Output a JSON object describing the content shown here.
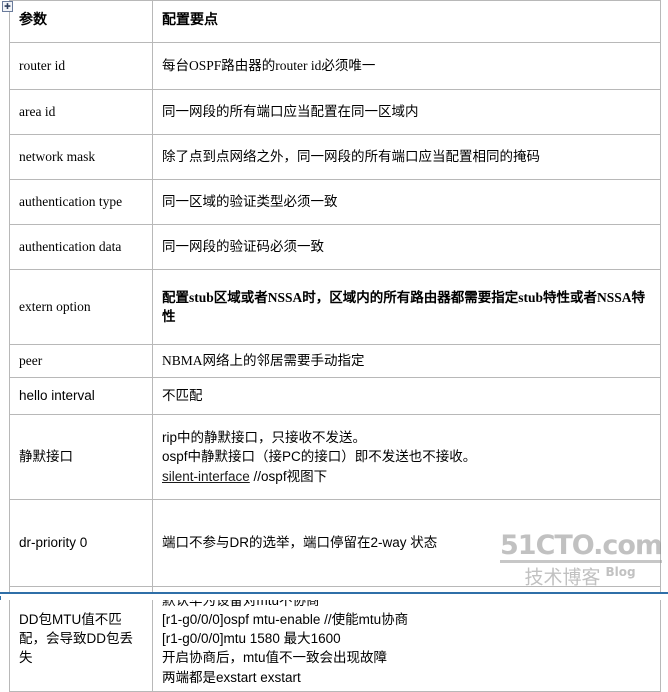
{
  "document": {
    "table_handle_icon": "table-move-handle",
    "columns": [
      "参数",
      "配置要点"
    ],
    "rows": [
      {
        "param": "router id",
        "param_font": "serif",
        "desc_lines": [
          "每台OSPF路由器的router id必须唯一"
        ],
        "desc_bold": false
      },
      {
        "param": "area id",
        "param_font": "serif",
        "desc_lines": [
          "同一网段的所有端口应当配置在同一区域内"
        ],
        "desc_bold": false
      },
      {
        "param": "network mask",
        "param_font": "serif",
        "desc_lines": [
          "除了点到点网络之外，同一网段的所有端口应当配置相同的掩码"
        ],
        "desc_bold": false
      },
      {
        "param": "authentication type",
        "param_font": "serif",
        "desc_lines": [
          "同一区域的验证类型必须一致"
        ],
        "desc_bold": false
      },
      {
        "param": "authentication data",
        "param_font": "serif",
        "desc_lines": [
          "同一网段的验证码必须一致"
        ],
        "desc_bold": false
      },
      {
        "param": "extern option",
        "param_font": "serif",
        "desc_lines": [
          "配置stub区域或者NSSA时，区域内的所有路由器都需要指定stub特性或者NSSA特性"
        ],
        "desc_bold": true
      },
      {
        "param": "peer",
        "param_font": "serif",
        "desc_lines": [
          "NBMA网络上的邻居需要手动指定"
        ],
        "desc_bold": false
      },
      {
        "param": "hello interval",
        "param_font": "sans",
        "desc_lines": [
          " 不匹配"
        ],
        "desc_bold": false
      },
      {
        "param": "静默接口",
        "param_font": "sans",
        "desc_lines": [
          "rip中的静默接口，只接收不发送。",
          "ospf中静默接口（接PC的接口）即不发送也不接收。",
          "silent-interface //ospf视图下"
        ],
        "desc_bold": false,
        "desc_font": "sans",
        "underline_line_index": 2,
        "underline_text": "silent-interface"
      },
      {
        "param": "dr-priority 0",
        "param_font": "sans",
        "desc_lines": [
          "端口不参与DR的选举，端口停留在2-way 状态"
        ],
        "desc_bold": false,
        "desc_font": "sans"
      },
      {
        "param": "DD包MTU值不匹配，会导致DD包丢失",
        "param_font": "sans",
        "desc_lines": [
          "默认华为设备对mtu不协商",
          "[r1-g0/0/0]ospf mtu-enable  //使能mtu协商",
          "[r1-g0/0/0]mtu 1580 最大1600",
          "开启协商后，mtu值不一致会出现故障",
          "两端都是exstart exstart"
        ],
        "desc_bold": false,
        "desc_font": "sans"
      }
    ]
  },
  "watermark": {
    "site": "51CTO.com",
    "tagline": "技术博客",
    "blog_label": "Blog"
  },
  "colors": {
    "border": "#b8b8b8",
    "text": "#000000",
    "watermark": "#8f8f8f",
    "accent": "#2f6fa8"
  }
}
